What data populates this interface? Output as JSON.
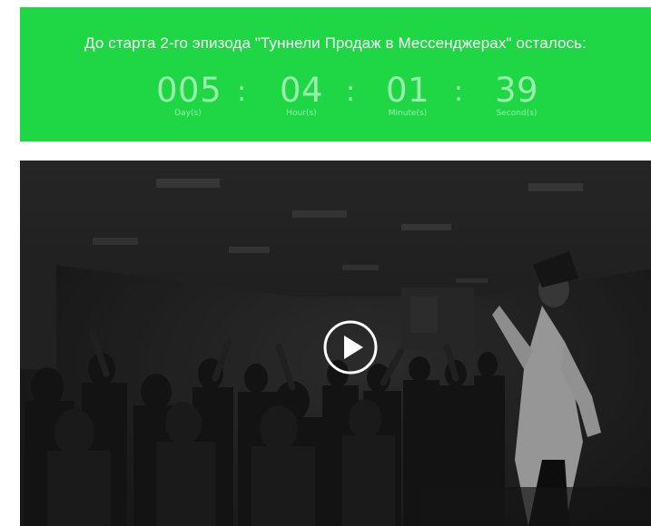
{
  "countdown": {
    "title": "До старта 2-го эпизода \"Туннели Продаж в Мессенджерах\" осталось:",
    "units": [
      {
        "value": "005",
        "label": "Day(s)"
      },
      {
        "value": "04",
        "label": "Hour(s)"
      },
      {
        "value": "01",
        "label": "Minute(s)"
      },
      {
        "value": "39",
        "label": "Second(s)"
      }
    ],
    "separator": ":"
  },
  "colors": {
    "banner_background": "#1fd745",
    "video_overlay": "#262626"
  },
  "video": {
    "play_icon": "play-circle-icon"
  }
}
